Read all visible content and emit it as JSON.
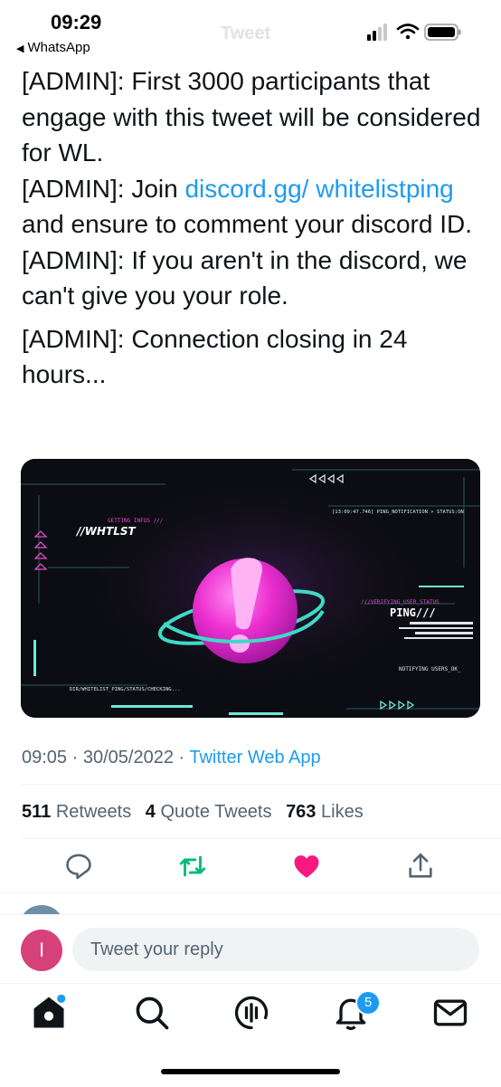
{
  "status_bar": {
    "time": "09:29",
    "back_app": "WhatsApp",
    "faded_title": "Tweet",
    "icons": [
      "signal-icon",
      "wifi-icon",
      "battery-icon"
    ]
  },
  "tweet": {
    "lines": [
      "[ADMIN]: First 3000 participants that engage with this tweet will be considered for WL.",
      "[ADMIN]: Join ",
      "discord.gg/ whitelistping",
      " and ensure to comment your discord ID.",
      "[ADMIN]: If you aren't in the discord, we can't give you your role.",
      "[ADMIN]: Connection closing in 24 hours..."
    ],
    "media": {
      "label_getting": "GETTING INFOS ///",
      "label_logo": "//WHTLST",
      "label_timestamp": "[13:09:47.746] PING_NOTIFICATION > STATUS:ON",
      "label_verify": "///VERIFYING_USER_STATUS",
      "label_ping": "PING///",
      "label_notify": "NOTIFYING USERS_OK_",
      "label_dir": "DIR/WHITELIST_PING/STATUS/CHECKING..."
    },
    "time": "09:05",
    "date": "30/05/2022",
    "source": "Twitter Web App",
    "retweets_count": "511",
    "retweets_label": "Retweets",
    "quotes_count": "4",
    "quotes_label": "Quote Tweets",
    "likes_count": "763",
    "likes_label": "Likes"
  },
  "colors": {
    "accent": "#1d9bf0",
    "like": "#f91880",
    "retweet": "#00ba7c",
    "avatar": "#d6417a"
  },
  "reply": {
    "avatar_letter": "I",
    "placeholder": "Tweet your reply"
  },
  "tabbar": {
    "notification_badge": "5"
  }
}
